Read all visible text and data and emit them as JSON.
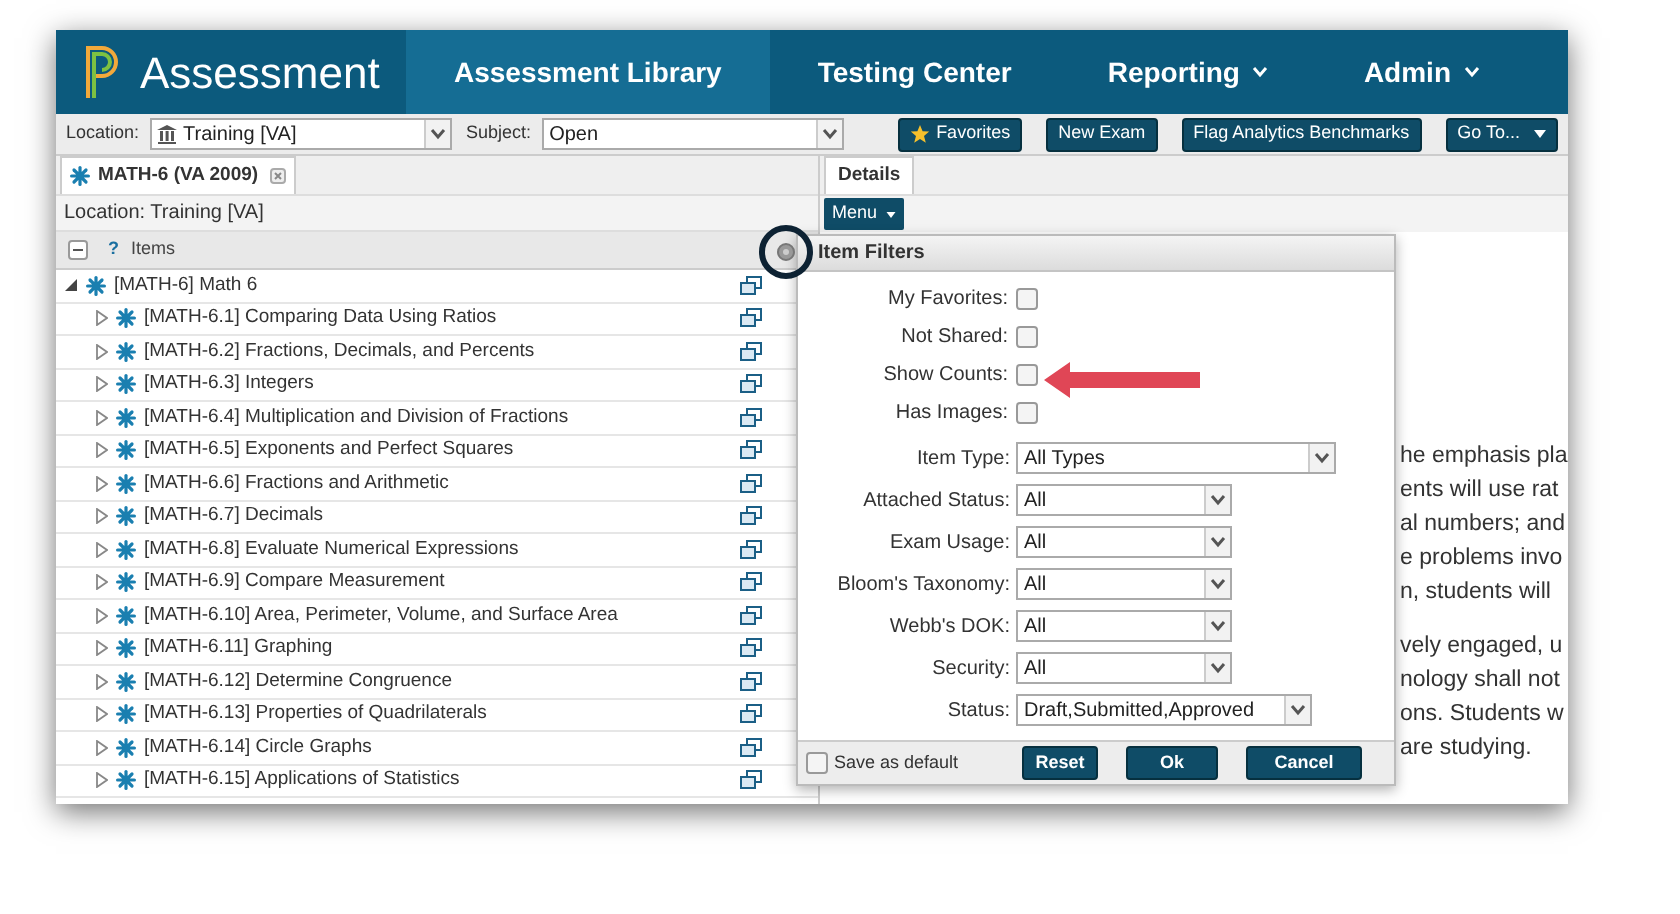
{
  "header": {
    "brand": "Assessment",
    "nav": [
      {
        "label": "Assessment Library",
        "selected": true,
        "dropdown": false
      },
      {
        "label": "Testing Center",
        "selected": false,
        "dropdown": false
      },
      {
        "label": "Reporting",
        "selected": false,
        "dropdown": true
      },
      {
        "label": "Admin",
        "selected": false,
        "dropdown": true
      }
    ]
  },
  "toolbar": {
    "location_label": "Location:",
    "location_value": "Training [VA]",
    "subject_label": "Subject:",
    "subject_value": "Open",
    "buttons": [
      {
        "label": "Favorites",
        "kind": "star"
      },
      {
        "label": "New Exam",
        "kind": "plain"
      },
      {
        "label": "Flag Analytics Benchmarks",
        "kind": "plain"
      },
      {
        "label": "Go To...",
        "kind": "menu"
      }
    ]
  },
  "left_panel": {
    "tab": "MATH-6 (VA 2009)",
    "location": "Location: Training [VA]",
    "tree_header": {
      "help": "?",
      "title": "Items"
    },
    "tree": {
      "label": "[MATH-6] Math 6",
      "expanded": true,
      "children": [
        {
          "label": "[MATH-6.1] Comparing Data Using Ratios",
          "expanded": false
        },
        {
          "label": "[MATH-6.2] Fractions, Decimals, and Percents",
          "expanded": false
        },
        {
          "label": "[MATH-6.3] Integers",
          "expanded": false
        },
        {
          "label": "[MATH-6.4] Multiplication and Division of Fractions",
          "expanded": false
        },
        {
          "label": "[MATH-6.5] Exponents and Perfect Squares",
          "expanded": false
        },
        {
          "label": "[MATH-6.6] Fractions and Arithmetic",
          "expanded": false
        },
        {
          "label": "[MATH-6.7] Decimals",
          "expanded": false
        },
        {
          "label": "[MATH-6.8] Evaluate Numerical Expressions",
          "expanded": false
        },
        {
          "label": "[MATH-6.9] Compare Measurement",
          "expanded": false
        },
        {
          "label": "[MATH-6.10] Area, Perimeter, Volume, and Surface Area",
          "expanded": false
        },
        {
          "label": "[MATH-6.11] Graphing",
          "expanded": false
        },
        {
          "label": "[MATH-6.12] Determine Congruence",
          "expanded": false
        },
        {
          "label": "[MATH-6.13] Properties of Quadrilaterals",
          "expanded": false
        },
        {
          "label": "[MATH-6.14] Circle Graphs",
          "expanded": false
        },
        {
          "label": "[MATH-6.15] Applications of Statistics",
          "expanded": false
        }
      ]
    }
  },
  "right_panel": {
    "tabs": [
      {
        "label": "Details",
        "selected": true
      }
    ],
    "menu_button": "Menu",
    "text_paragraphs": [
      [
        "he emphasis pla",
        "ents will use rat",
        "al numbers; and",
        "e problems invo",
        "n, students will"
      ],
      [
        "vely engaged, u",
        "nology shall not",
        "ons. Students w",
        "are studying."
      ]
    ]
  },
  "filters_popup": {
    "title": "Item Filters",
    "checkboxes": [
      {
        "label": "My Favorites:",
        "checked": false
      },
      {
        "label": "Not Shared:",
        "checked": false
      },
      {
        "label": "Show Counts:",
        "checked": false
      },
      {
        "label": "Has Images:",
        "checked": false
      }
    ],
    "selects": [
      {
        "label": "Item Type:",
        "value": "All Types",
        "kind": "wide"
      },
      {
        "label": "Attached Status:",
        "value": "All",
        "kind": "short"
      },
      {
        "label": "Exam Usage:",
        "value": "All",
        "kind": "short"
      },
      {
        "label": "Bloom's Taxonomy:",
        "value": "All",
        "kind": "short"
      },
      {
        "label": "Webb's DOK:",
        "value": "All",
        "kind": "short"
      },
      {
        "label": "Security:",
        "value": "All",
        "kind": "short"
      },
      {
        "label": "Status:",
        "value": "Draft,Submitted,Approved",
        "kind": "medium"
      }
    ],
    "save_default": {
      "label": "Save as default",
      "checked": false
    },
    "buttons": [
      "Reset",
      "Ok",
      "Cancel"
    ]
  }
}
